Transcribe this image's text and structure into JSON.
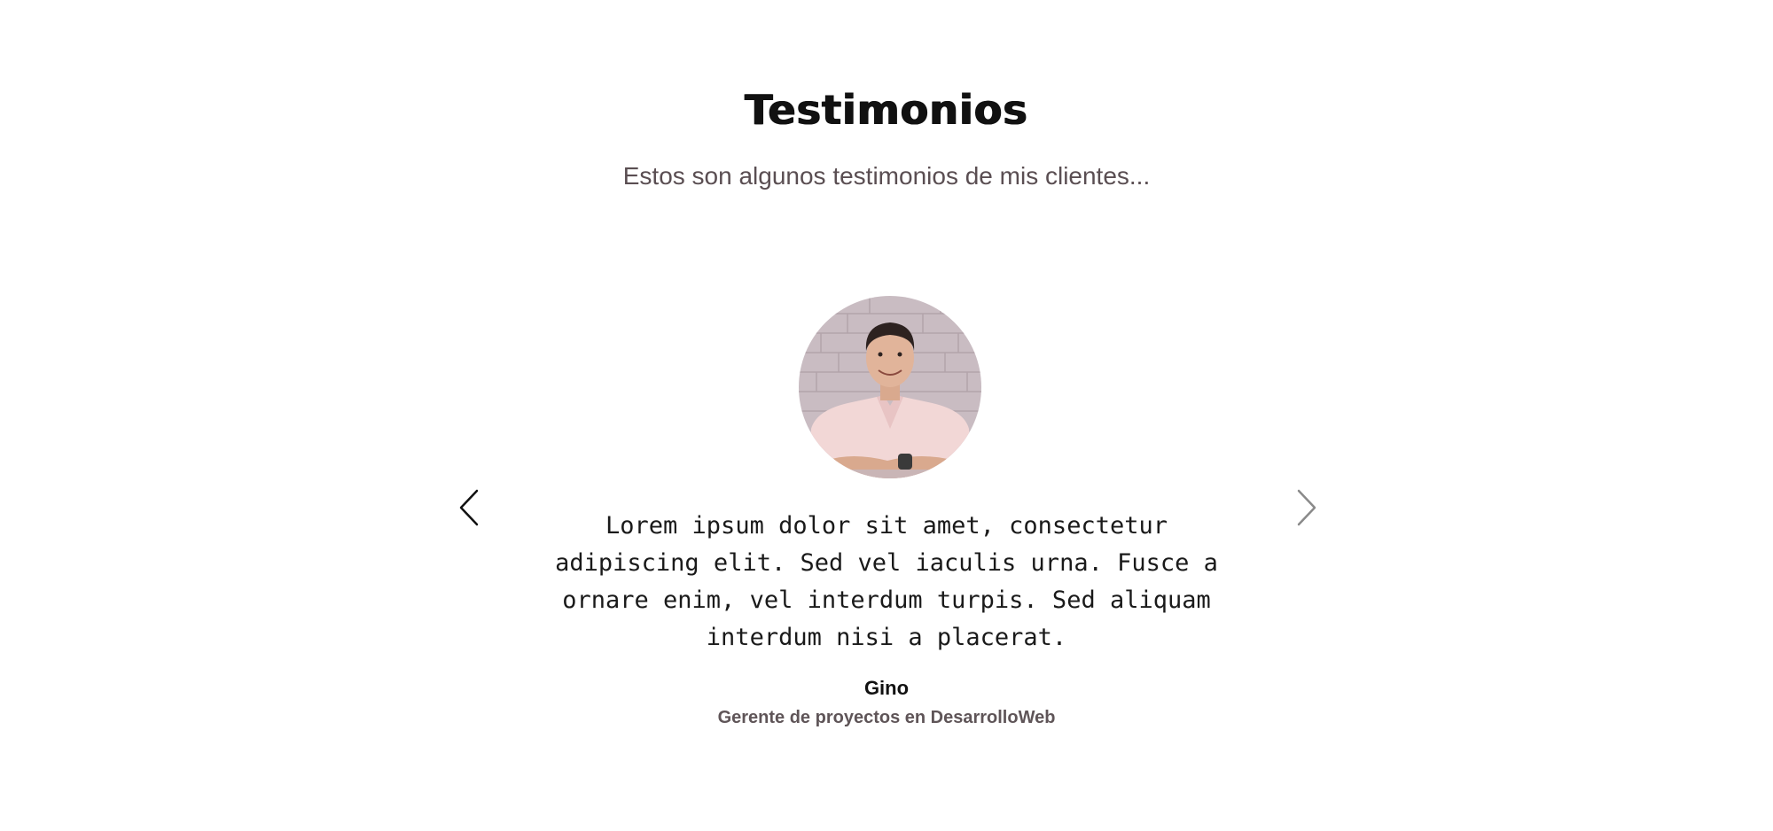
{
  "section": {
    "title": "Testimonios",
    "subtitle": "Estos son algunos testimonios de mis clientes..."
  },
  "testimonial": {
    "quote": "Lorem ipsum dolor sit amet, consectetur adipiscing elit. Sed vel iaculis urna. Fusce a ornare enim, vel interdum turpis. Sed aliquam interdum nisi a placerat.",
    "name": "Gino",
    "role": "Gerente de proyectos en DesarrolloWeb"
  },
  "icons": {
    "prev": "chevron-left-icon",
    "next": "chevron-right-icon"
  },
  "colors": {
    "title": "#111111",
    "subtitle": "#5a4e52",
    "role": "#5f5558",
    "next_arrow": "#8a8a8a"
  }
}
